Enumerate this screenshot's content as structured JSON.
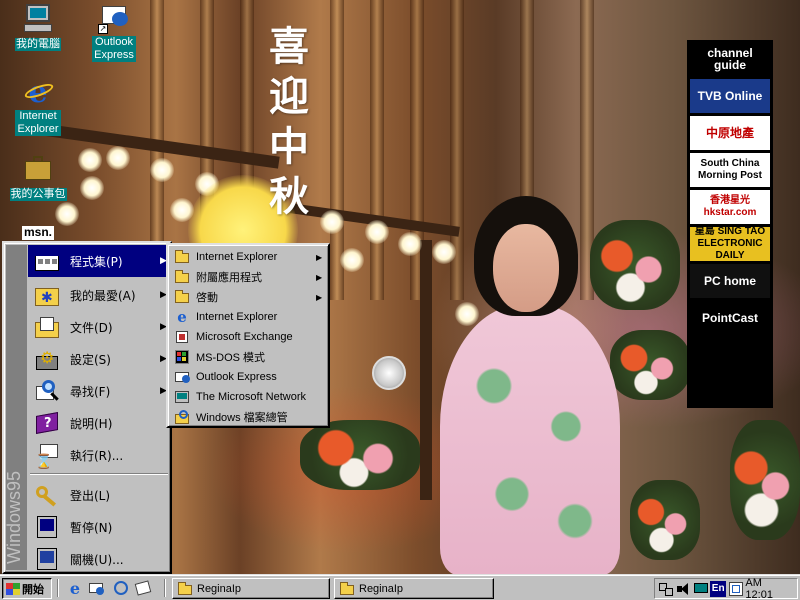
{
  "wallpaper": {
    "poem_chars": [
      "喜",
      "迎",
      "中",
      "秋"
    ]
  },
  "desktop_icons": [
    {
      "label": "我的電腦"
    },
    {
      "label": "Outlook Express"
    },
    {
      "label": "Internet Explorer"
    },
    {
      "label": "我的公事包"
    },
    {
      "label": "msn."
    }
  ],
  "channel_bar": {
    "items": [
      {
        "label": "channel guide",
        "bg": "#000000",
        "fg": "#ffffff"
      },
      {
        "label": "TVB Online",
        "bg": "#1a3a8a",
        "fg": "#ffffff"
      },
      {
        "label": "中原地產",
        "bg": "#ffffff",
        "fg": "#c00000"
      },
      {
        "label": "South China Morning Post",
        "bg": "#ffffff",
        "fg": "#000000"
      },
      {
        "label": "香港星光 hkstar.com",
        "bg": "#ffffff",
        "fg": "#c00000"
      },
      {
        "label": "星島 SING TAO ELECTRONIC DAILY",
        "bg": "#e8c020",
        "fg": "#000000"
      },
      {
        "label": "PC home",
        "bg": "#101010",
        "fg": "#ffffff"
      },
      {
        "label": "PointCast",
        "bg": "#000000",
        "fg": "#ffffff"
      }
    ]
  },
  "start_menu": {
    "banner": "Windows95",
    "items": [
      {
        "label": "程式集(P)",
        "arrow": "▶"
      },
      {
        "label": "我的最愛(A)",
        "arrow": "▶"
      },
      {
        "label": "文件(D)",
        "arrow": "▶"
      },
      {
        "label": "設定(S)",
        "arrow": "▶"
      },
      {
        "label": "尋找(F)",
        "arrow": "▶"
      },
      {
        "label": "說明(H)",
        "arrow": ""
      },
      {
        "label": "執行(R)...",
        "arrow": ""
      },
      {
        "label": "登出(L)",
        "arrow": ""
      },
      {
        "label": "暫停(N)",
        "arrow": ""
      },
      {
        "label": "關機(U)...",
        "arrow": ""
      }
    ]
  },
  "programs_menu": {
    "items": [
      {
        "label": "Internet Explorer",
        "icon": "folder-icon",
        "arrow": "▶"
      },
      {
        "label": "附屬應用程式",
        "icon": "folder-icon",
        "arrow": "▶"
      },
      {
        "label": "啓動",
        "icon": "folder-icon",
        "arrow": "▶"
      },
      {
        "label": "Internet Explorer",
        "icon": "ie-icon",
        "arrow": ""
      },
      {
        "label": "Microsoft Exchange",
        "icon": "exchange-icon",
        "arrow": ""
      },
      {
        "label": "MS-DOS 模式",
        "icon": "msdos-icon",
        "arrow": ""
      },
      {
        "label": "Outlook Express",
        "icon": "outlook-icon",
        "arrow": ""
      },
      {
        "label": "The Microsoft Network",
        "icon": "msn-icon",
        "arrow": ""
      },
      {
        "label": "Windows 檔案總管",
        "icon": "explorer-icon",
        "arrow": ""
      }
    ]
  },
  "taskbar": {
    "start_label": "開始",
    "tasks": [
      {
        "label": "ReginaIp"
      },
      {
        "label": "ReginaIp"
      }
    ],
    "tray": {
      "lang": "En",
      "clock": "AM 12:01"
    }
  }
}
